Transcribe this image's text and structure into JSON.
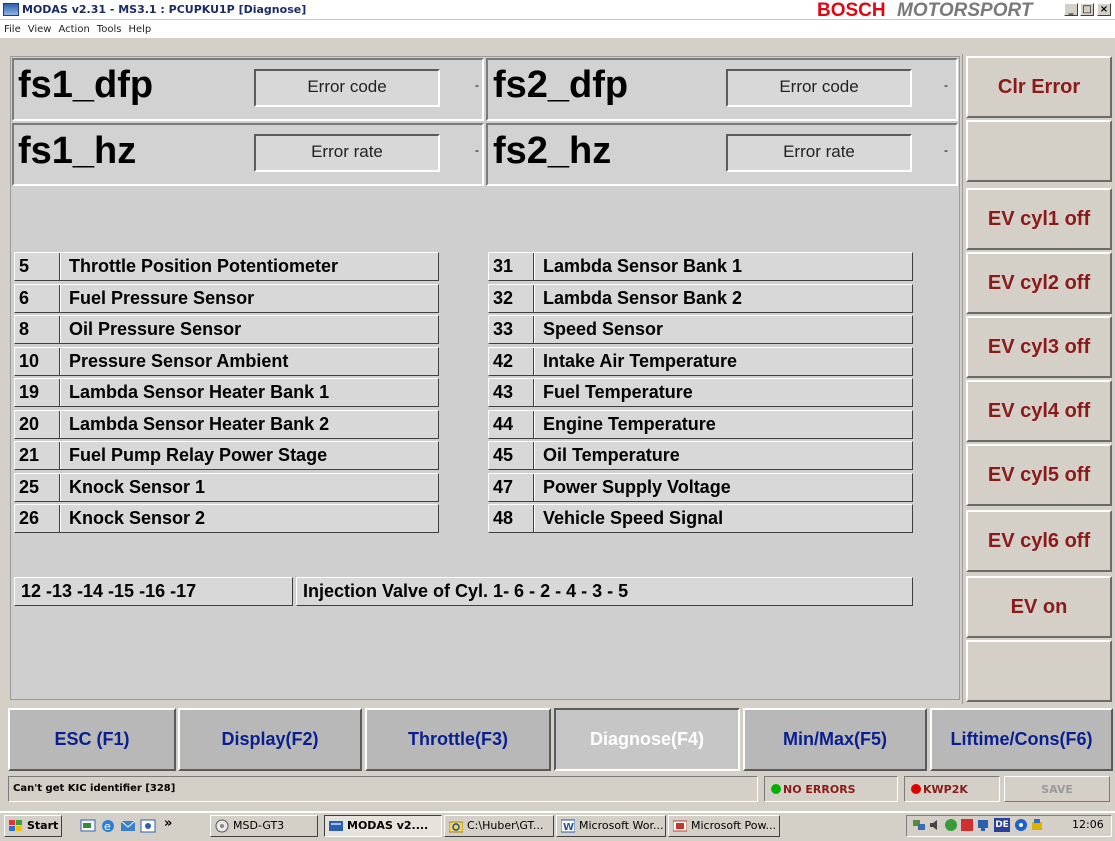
{
  "window": {
    "title": "MODAS v2.31 - MS3.1 : PCUPKU1P   [Diagnose]",
    "brand_bosch": "BOSCH",
    "brand_motorsport": "MOTORSPORT",
    "controls": [
      "_",
      "□",
      "×"
    ]
  },
  "menu": [
    "File",
    "View",
    "Action",
    "Tools",
    "Help"
  ],
  "error_panel": {
    "fs1_dfp": {
      "label": "fs1_dfp",
      "value": "Error code",
      "dash": "-"
    },
    "fs2_dfp": {
      "label": "fs2_dfp",
      "value": "Error code",
      "dash": "-"
    },
    "fs1_hz": {
      "label": "fs1_hz",
      "value": "Error rate",
      "dash": "-"
    },
    "fs2_hz": {
      "label": "fs2_hz",
      "value": "Error rate",
      "dash": "-"
    }
  },
  "sensors_left": [
    {
      "code": "5",
      "desc": "Throttle Position Potentiometer"
    },
    {
      "code": "6",
      "desc": "Fuel Pressure Sensor"
    },
    {
      "code": "8",
      "desc": "Oil Pressure Sensor"
    },
    {
      "code": "10",
      "desc": "Pressure Sensor Ambient"
    },
    {
      "code": "19",
      "desc": "Lambda Sensor Heater Bank 1"
    },
    {
      "code": "20",
      "desc": "Lambda Sensor Heater Bank 2"
    },
    {
      "code": "21",
      "desc": "Fuel Pump Relay Power Stage"
    },
    {
      "code": "25",
      "desc": "Knock Sensor 1"
    },
    {
      "code": "26",
      "desc": "Knock Sensor 2"
    }
  ],
  "sensors_right": [
    {
      "code": "31",
      "desc": "Lambda Sensor Bank 1"
    },
    {
      "code": "32",
      "desc": "Lambda Sensor Bank 2"
    },
    {
      "code": "33",
      "desc": "Speed Sensor"
    },
    {
      "code": "42",
      "desc": "Intake Air Temperature"
    },
    {
      "code": "43",
      "desc": "Fuel Temperature"
    },
    {
      "code": "44",
      "desc": "Engine Temperature"
    },
    {
      "code": "45",
      "desc": "Oil Temperature"
    },
    {
      "code": "47",
      "desc": "Power Supply Voltage"
    },
    {
      "code": "48",
      "desc": "Vehicle Speed Signal"
    }
  ],
  "injection": {
    "codes": "12 -13 -14 -15 -16 -17",
    "desc": "Injection Valve of Cyl. 1- 6 - 2 - 4 - 3 - 5"
  },
  "side_buttons": {
    "clr_error": "Clr Error",
    "ev_cyl1": "EV cyl1 off",
    "ev_cyl2": "EV cyl2 off",
    "ev_cyl3": "EV cyl3 off",
    "ev_cyl4": "EV cyl4 off",
    "ev_cyl5": "EV cyl5 off",
    "ev_cyl6": "EV cyl6 off",
    "ev_on": "EV on"
  },
  "fkeys": [
    "ESC (F1)",
    "Display(F2)",
    "Throttle(F3)",
    "Diagnose(F4)",
    "Min/Max(F5)",
    "Liftime/Cons(F6)"
  ],
  "active_fkey": "Diagnose(F4)",
  "status": {
    "message": "Can't get KIC identifier [328]",
    "no_errors": "NO ERRORS",
    "kwp": "KWP2K",
    "save": "SAVE",
    "no_errors_color": "#00b000",
    "kwp_color": "#e00000"
  },
  "taskbar": {
    "start": "Start",
    "chevron": "»",
    "items": [
      "MSD-GT3",
      "MODAS v2....",
      "C:\\Huber\\GT...",
      "Microsoft Wor...",
      "Microsoft Pow..."
    ],
    "clock": "12:06",
    "lang": "DE"
  }
}
